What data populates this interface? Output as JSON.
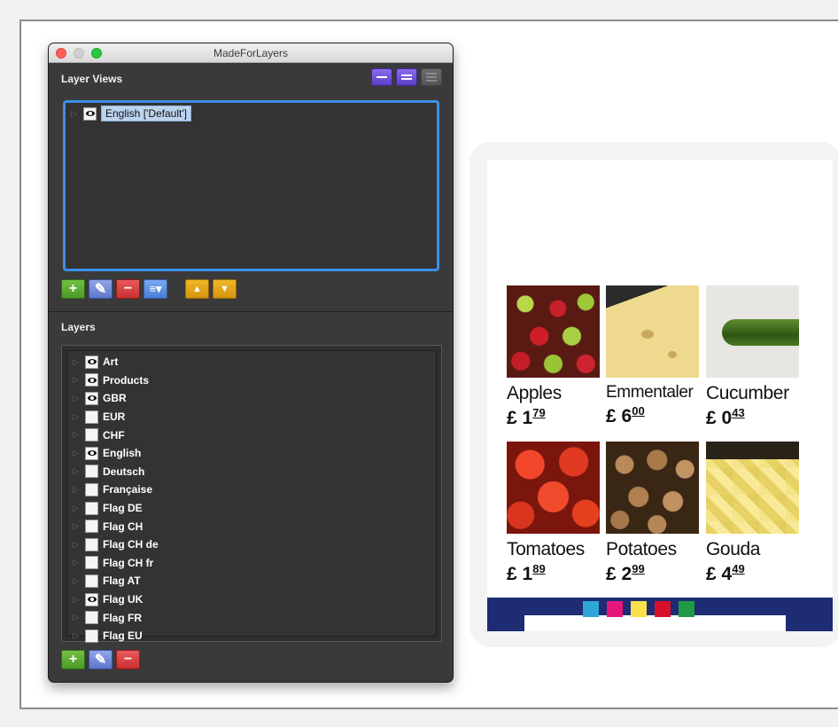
{
  "window": {
    "title": "MadeForLayers"
  },
  "layer_views": {
    "label": "Layer Views",
    "items": [
      {
        "name": "English ['Default']",
        "visible": true,
        "selected": true
      }
    ],
    "toolbar_icons": [
      "add-icon",
      "edit-pencil-icon",
      "remove-icon",
      "menu-icon",
      "move-up-icon",
      "move-down-icon"
    ]
  },
  "layers": {
    "label": "Layers",
    "items": [
      {
        "name": "Art",
        "visible": true
      },
      {
        "name": "Products",
        "visible": true
      },
      {
        "name": "GBR",
        "visible": true
      },
      {
        "name": "EUR",
        "visible": false
      },
      {
        "name": "CHF",
        "visible": false
      },
      {
        "name": "English",
        "visible": true
      },
      {
        "name": "Deutsch",
        "visible": false
      },
      {
        "name": "Française",
        "visible": false
      },
      {
        "name": "Flag DE",
        "visible": false
      },
      {
        "name": "Flag CH",
        "visible": false
      },
      {
        "name": "Flag CH de",
        "visible": false
      },
      {
        "name": "Flag CH fr",
        "visible": false
      },
      {
        "name": "Flag AT",
        "visible": false
      },
      {
        "name": "Flag UK",
        "visible": true
      },
      {
        "name": "Flag FR",
        "visible": false
      },
      {
        "name": "Flag EU",
        "visible": false
      }
    ]
  },
  "preview": {
    "products": [
      {
        "name": "Apples",
        "currency": "£",
        "units": "1",
        "cents": "79"
      },
      {
        "name": "Emmentaler",
        "currency": "£",
        "units": "6",
        "cents": "00"
      },
      {
        "name": "Cucumber",
        "currency": "£",
        "units": "0",
        "cents": "43"
      },
      {
        "name": "Tomatoes",
        "currency": "£",
        "units": "1",
        "cents": "89"
      },
      {
        "name": "Potatoes",
        "currency": "£",
        "units": "2",
        "cents": "99"
      },
      {
        "name": "Gouda",
        "currency": "£",
        "units": "4",
        "cents": "49"
      }
    ],
    "swatch_colors": [
      "#2ea7d8",
      "#e5177b",
      "#f8e04c",
      "#d8102a",
      "#1f9b46"
    ],
    "band_color": "#1d2c73"
  }
}
